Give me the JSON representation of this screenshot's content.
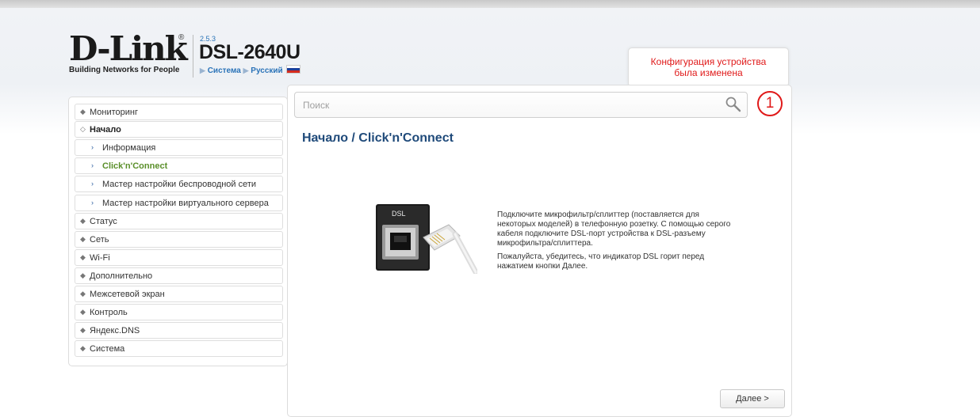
{
  "header": {
    "brand": "D-Link",
    "registered_mark": "®",
    "tagline": "Building Networks for People",
    "version": "2.5.3",
    "model": "DSL-2640U",
    "crumb_system": "Система",
    "crumb_language": "Русский"
  },
  "notice": {
    "line1": "Конфигурация устройства",
    "line2": "была изменена",
    "counter": "1"
  },
  "search": {
    "placeholder": "Поиск"
  },
  "sidebar": {
    "items": [
      {
        "label": "Мониторинг"
      },
      {
        "label": "Начало"
      },
      {
        "label": "Информация"
      },
      {
        "label": "Click'n'Connect"
      },
      {
        "label": "Мастер настройки беспроводной сети"
      },
      {
        "label": "Мастер настройки виртуального сервера"
      },
      {
        "label": "Статус"
      },
      {
        "label": "Сеть"
      },
      {
        "label": "Wi-Fi"
      },
      {
        "label": "Дополнительно"
      },
      {
        "label": "Межсетевой экран"
      },
      {
        "label": "Контроль"
      },
      {
        "label": "Яндекс.DNS"
      },
      {
        "label": "Система"
      }
    ]
  },
  "main": {
    "title": "Начало /  Click'n'Connect",
    "image_label": "DSL",
    "paragraph1": "Подключите микрофильтр/сплиттер (поставляется для некоторых моделей) в телефонную розетку. С помощью серого кабеля подключите DSL-порт устройства к DSL-разъему микрофильтра/сплиттера.",
    "paragraph2": "Пожалуйста, убедитесь, что индикатор DSL горит перед нажатием кнопки Далее.",
    "next_label": "Далее >"
  },
  "colors": {
    "accent_blue": "#2a73b8",
    "alert_red": "#e01919",
    "active_green": "#5a8f2a",
    "title_blue": "#1f4a7a"
  }
}
